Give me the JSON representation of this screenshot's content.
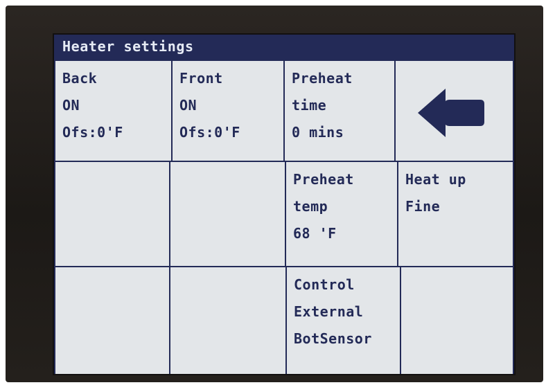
{
  "screen": {
    "title": "Heater settings"
  },
  "cells": {
    "back": {
      "line1": "Back",
      "line2": "ON",
      "line3": "Ofs:0'F"
    },
    "front": {
      "line1": "Front",
      "line2": "ON",
      "line3": "Ofs:0'F"
    },
    "preheat_time": {
      "line1": "Preheat",
      "line2": "time",
      "line3": "0 mins"
    },
    "back_button": {
      "icon": "back-arrow-icon"
    },
    "preheat_temp": {
      "line1": "Preheat",
      "line2": "temp",
      "line3": "68 'F"
    },
    "heat_up": {
      "line1": "Heat up",
      "line2": "Fine"
    },
    "control": {
      "line1": "Control",
      "line2": "External",
      "line3": "BotSensor"
    }
  },
  "colors": {
    "title_bar": "#232a57",
    "text": "#232a57",
    "cell_background": "#e3e6e9",
    "bezel": "#1f1b18"
  }
}
